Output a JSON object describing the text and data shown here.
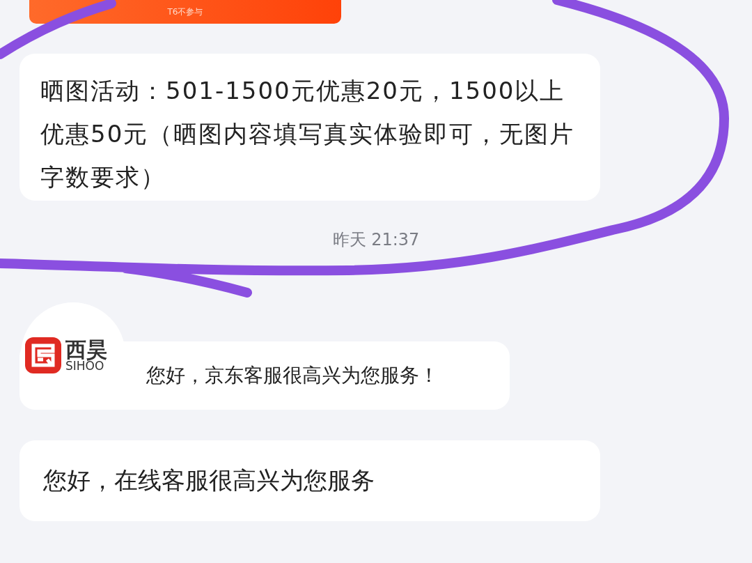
{
  "banner": {
    "text": "T6不参与"
  },
  "messages": [
    {
      "kind": "notice",
      "text": "晒图活动：501-1500元优惠20元，1500以上优惠50元（晒图内容填写真实体验即可，无图片字数要求）"
    },
    {
      "kind": "timestamp",
      "text": "昨天 21:37"
    },
    {
      "kind": "agent",
      "logo_cn": "西昊",
      "logo_en": "SIHOO",
      "text": "您好，京东客服很高兴为您服务！"
    },
    {
      "kind": "plain",
      "text": "您好，在线客服很高兴为您服务"
    }
  ]
}
